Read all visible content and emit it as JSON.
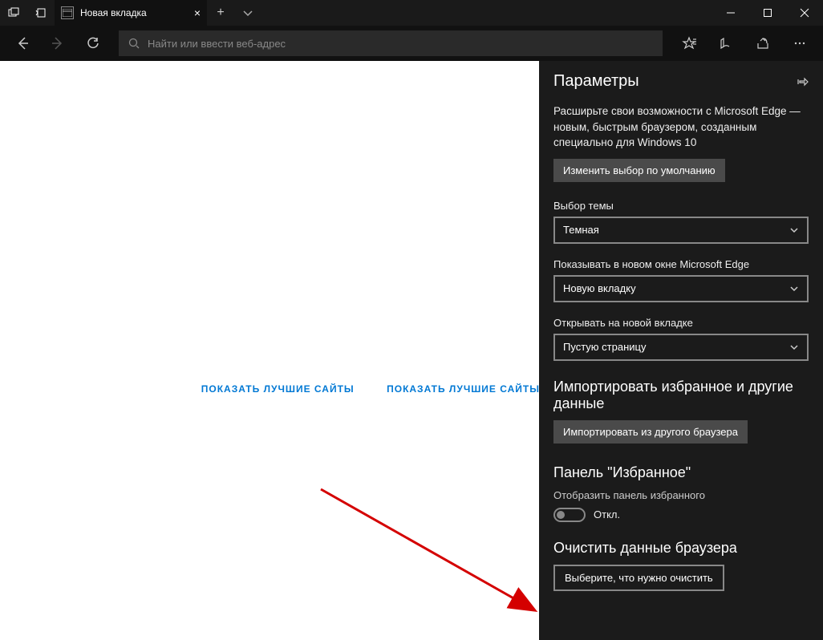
{
  "titlebar": {
    "tab_title": "Новая вкладка"
  },
  "toolbar": {
    "search_placeholder": "Найти или ввести веб-адрес"
  },
  "content_links": {
    "link1": "ПОКАЗАТЬ ЛУЧШИЕ САЙТЫ",
    "link2": "ПОКАЗАТЬ ЛУЧШИЕ САЙТЫ И МОЮ ЛЕНТУ"
  },
  "panel": {
    "title": "Параметры",
    "promo_text": "Расширьте свои возможности с Microsoft Edge — новым, быстрым браузером, созданным специально для Windows 10",
    "change_default_btn": "Изменить выбор по умолчанию",
    "theme_label": "Выбор темы",
    "theme_value": "Темная",
    "open_with_label": "Показывать в новом окне Microsoft Edge",
    "open_with_value": "Новую вкладку",
    "new_tab_label": "Открывать на новой вкладке",
    "new_tab_value": "Пустую страницу",
    "import_heading": "Импортировать избранное и другие данные",
    "import_button": "Импортировать из другого браузера",
    "fav_heading": "Панель \"Избранное\"",
    "fav_toggle_label": "Отобразить панель избранного",
    "fav_toggle_state": "Откл.",
    "clear_heading": "Очистить данные браузера",
    "clear_button": "Выберите, что нужно очистить"
  }
}
